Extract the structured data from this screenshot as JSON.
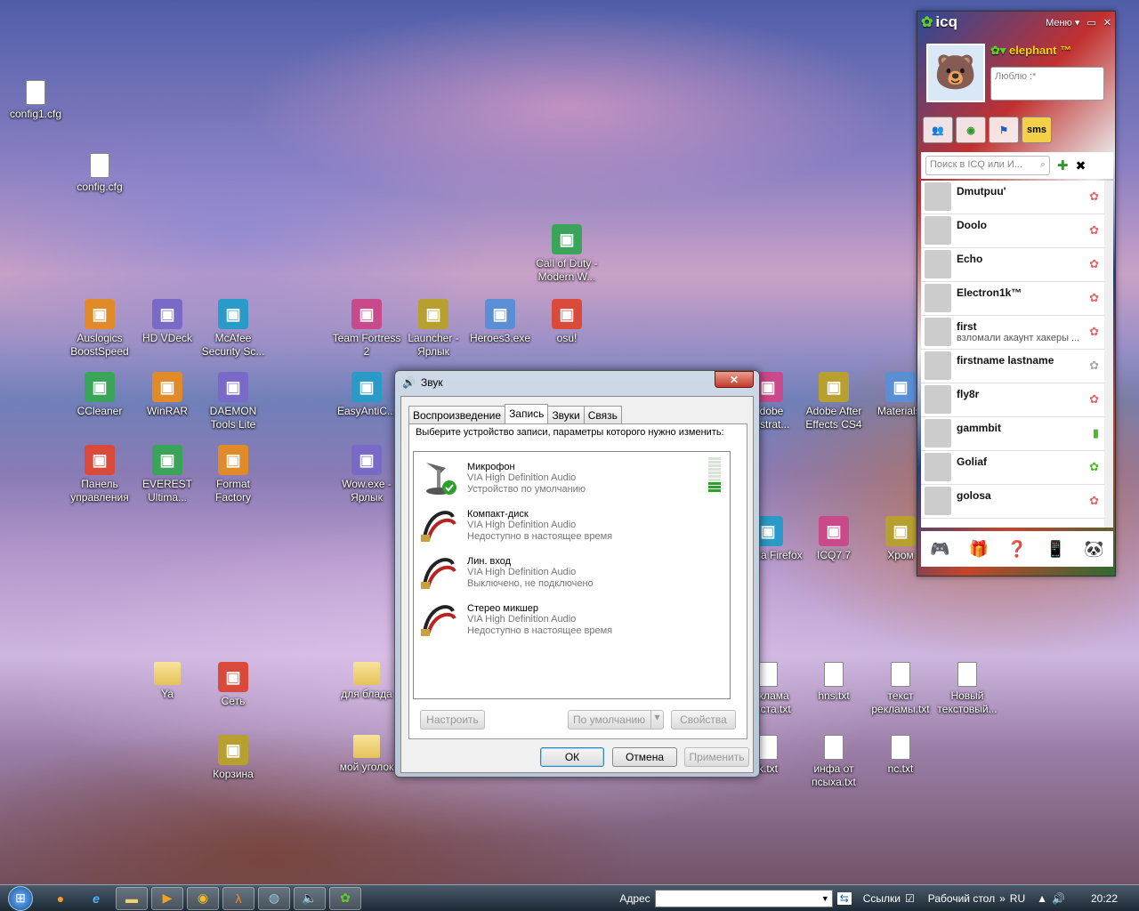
{
  "desktop": {
    "icons": [
      {
        "label": "config1.cfg",
        "kind": "file"
      },
      {
        "label": "config.cfg",
        "kind": "file"
      },
      {
        "label": "Call of Duty - Modern W...",
        "kind": "game"
      },
      {
        "label": "Auslogics BoostSpeed",
        "kind": "app"
      },
      {
        "label": "HD VDeck",
        "kind": "app"
      },
      {
        "label": "McAfee Security Sc...",
        "kind": "app"
      },
      {
        "label": "Team Fortress 2",
        "kind": "game"
      },
      {
        "label": "Launcher - Ярлык",
        "kind": "app"
      },
      {
        "label": "Heroes3.exe",
        "kind": "game"
      },
      {
        "label": "osu!",
        "kind": "game"
      },
      {
        "label": "CCleaner",
        "kind": "app"
      },
      {
        "label": "WinRAR",
        "kind": "app"
      },
      {
        "label": "DAEMON Tools Lite",
        "kind": "app"
      },
      {
        "label": "EasyAntiC...",
        "kind": "app"
      },
      {
        "label": "Adobe Illustrat...",
        "kind": "app"
      },
      {
        "label": "Adobe After Effects CS4",
        "kind": "app"
      },
      {
        "label": "Materials.",
        "kind": "app"
      },
      {
        "label": "Панель управления",
        "kind": "app"
      },
      {
        "label": "EVEREST Ultima...",
        "kind": "app"
      },
      {
        "label": "Format Factory",
        "kind": "app"
      },
      {
        "label": "Wow.exe - Ярлык",
        "kind": "game"
      },
      {
        "label": "Mozilla Firefox",
        "kind": "app"
      },
      {
        "label": "ICQ7.7",
        "kind": "app"
      },
      {
        "label": "Хром",
        "kind": "app"
      },
      {
        "label": "Ya",
        "kind": "folder"
      },
      {
        "label": "Сеть",
        "kind": "app"
      },
      {
        "label": "для блада",
        "kind": "folder"
      },
      {
        "label": "реклама текста.txt",
        "kind": "file"
      },
      {
        "label": "hns.txt",
        "kind": "file"
      },
      {
        "label": "текст рекламы.txt",
        "kind": "file"
      },
      {
        "label": "Новый текстовый...",
        "kind": "file"
      },
      {
        "label": "Корзина",
        "kind": "app"
      },
      {
        "label": "мой уголок",
        "kind": "folder"
      },
      {
        "label": "k.txt",
        "kind": "file"
      },
      {
        "label": "инфа от псыха.txt",
        "kind": "file"
      },
      {
        "label": "nc.txt",
        "kind": "file"
      }
    ]
  },
  "icq": {
    "logo": "icq",
    "menu": "Меню",
    "username": "elephant ™",
    "status_message": "Люблю :*",
    "tabs": [
      "contacts",
      "status",
      "flag",
      "sms"
    ],
    "sms_label": "sms",
    "search_placeholder": "Поиск в ICQ или И...",
    "contacts": [
      {
        "name": "Dmutpuu'",
        "sub": ""
      },
      {
        "name": "Doolo",
        "sub": ""
      },
      {
        "name": "Echo",
        "sub": ""
      },
      {
        "name": "Electron1k™",
        "sub": ""
      },
      {
        "name": "first",
        "sub": "взломали акаунт хакеры ..."
      },
      {
        "name": "firstname lastname",
        "sub": ""
      },
      {
        "name": "fly8r",
        "sub": ""
      },
      {
        "name": "gammbit",
        "sub": ""
      },
      {
        "name": "Goliaf",
        "sub": ""
      },
      {
        "name": "golosa",
        "sub": ""
      }
    ]
  },
  "dialog": {
    "title": "Звук",
    "close": "✕",
    "tabs": [
      "Воспроизведение",
      "Запись",
      "Звуки",
      "Связь"
    ],
    "active_tab": "Запись",
    "instruction": "Выберите устройство записи, параметры которого нужно изменить:",
    "devices": [
      {
        "name": "Микрофон",
        "driver": "VIA High Definition Audio",
        "state": "Устройство по умолчанию",
        "level": 0.3
      },
      {
        "name": "Компакт-диск",
        "driver": "VIA High Definition Audio",
        "state": "Недоступно в настоящее время"
      },
      {
        "name": "Лин. вход",
        "driver": "VIA High Definition Audio",
        "state": "Выключено, не подключено"
      },
      {
        "name": "Стерео микшер",
        "driver": "VIA High Definition Audio",
        "state": "Недоступно в настоящее время"
      }
    ],
    "buttons": {
      "configure": "Настроить",
      "default": "По умолчанию",
      "properties": "Свойства",
      "ok": "ОК",
      "cancel": "Отмена",
      "apply": "Применить"
    }
  },
  "taskbar": {
    "address_label": "Адрес",
    "links": "Ссылки",
    "desktop": "Рабочий стол",
    "lang": "RU",
    "time": "20:22"
  }
}
